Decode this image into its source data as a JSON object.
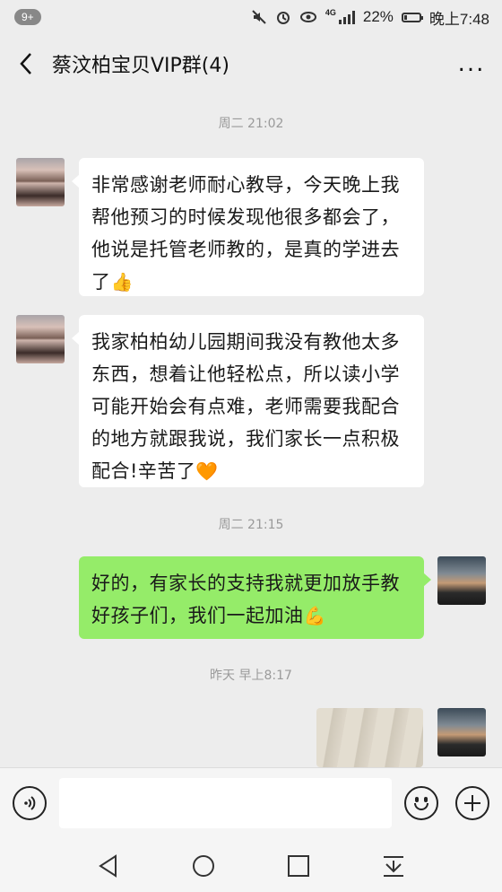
{
  "status_bar": {
    "notification_badge": "9+",
    "network": "4G",
    "battery": "22%",
    "battery_level": 0.22,
    "time": "晚上7:48"
  },
  "header": {
    "title": "蔡汶柏宝贝VIP群(4)",
    "more": "..."
  },
  "messages": {
    "ts1": "周二 21:02",
    "msg1": "非常感谢老师耐心教导，今天晚上我帮他预习的时候发现他很多都会了，他说是托管老师教的，是真的学进去了",
    "msg1_emoji": "👍",
    "msg2": "我家柏柏幼儿园期间我没有教他太多东西，想着让他轻松点，所以读小学可能开始会有点难，老师需要我配合的地方就跟我说，我们家长一点积极配合!辛苦了",
    "msg2_emoji": "🧡",
    "ts2": "周二 21:15",
    "msg3": "好的，有家长的支持我就更加放手教好孩子们，我们一起加油",
    "msg3_emoji": "💪",
    "ts3": "昨天 早上8:17"
  },
  "icons": {
    "voice": "voice-icon",
    "emoji": "emoji-icon",
    "plus": "plus-icon",
    "back": "back-arrow-icon",
    "nav_back": "triangle-back-icon",
    "nav_home": "circle-home-icon",
    "nav_recent": "square-recent-icon",
    "nav_notify": "pull-down-icon"
  },
  "colors": {
    "background": "#ededed",
    "sent_bubble": "#95ec69",
    "received_bubble": "#ffffff"
  }
}
